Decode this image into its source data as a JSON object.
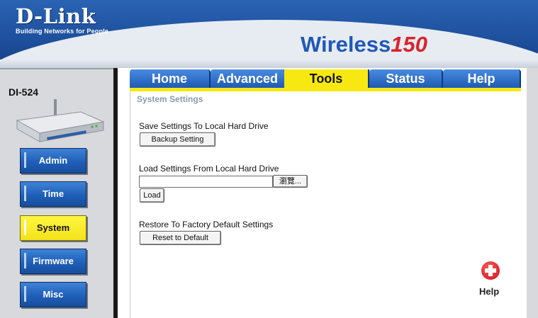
{
  "brand": {
    "name": "D-Link",
    "tagline": "Building Networks for People"
  },
  "product": {
    "word": "Wireless",
    "number": "150"
  },
  "model": "DI-524",
  "sidebar": {
    "items": [
      {
        "label": "Admin",
        "active": false
      },
      {
        "label": "Time",
        "active": false
      },
      {
        "label": "System",
        "active": true
      },
      {
        "label": "Firmware",
        "active": false
      },
      {
        "label": "Misc",
        "active": false
      }
    ]
  },
  "tabs": [
    {
      "label": "Home",
      "active": false
    },
    {
      "label": "Advanced",
      "active": false
    },
    {
      "label": "Tools",
      "active": true
    },
    {
      "label": "Status",
      "active": false
    },
    {
      "label": "Help",
      "active": false
    }
  ],
  "main": {
    "title": "System Settings",
    "save": {
      "label": "Save Settings To Local Hard Drive",
      "button": "Backup Setting"
    },
    "load": {
      "label": "Load Settings From Local Hard Drive",
      "file_value": "",
      "browse_button": "瀏覽...",
      "button": "Load"
    },
    "restore": {
      "label": "Restore To Factory Default Settings",
      "button": "Reset to Default"
    }
  },
  "help": {
    "label": "Help"
  },
  "colors": {
    "header_blue": "#1d4f9c",
    "nav_blue": "#1f5fb8",
    "active_yellow": "#f7e812",
    "help_red": "#d9232c"
  }
}
